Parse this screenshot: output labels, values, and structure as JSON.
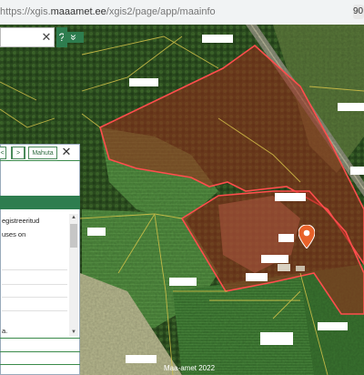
{
  "browser": {
    "url_prefix": "https://xgis.",
    "url_domain": "maaamet.ee",
    "url_path": "/xgis2/page/app/maainfo",
    "zoom": "90"
  },
  "toolbar": {
    "clear_icon": "✕",
    "help_label": "?",
    "collapse_icon": "»"
  },
  "panel": {
    "btn_prev": "<",
    "btn_next": ">",
    "btn_mahuta": "Mahuta",
    "close_icon": "✕",
    "text_line1": "egistreeritud",
    "text_line2": "uses on",
    "text_line3": "a."
  },
  "map": {
    "credit": "Maa-amet 2022",
    "pin_color": "#e8622a",
    "parcel_color": "#e53935"
  }
}
